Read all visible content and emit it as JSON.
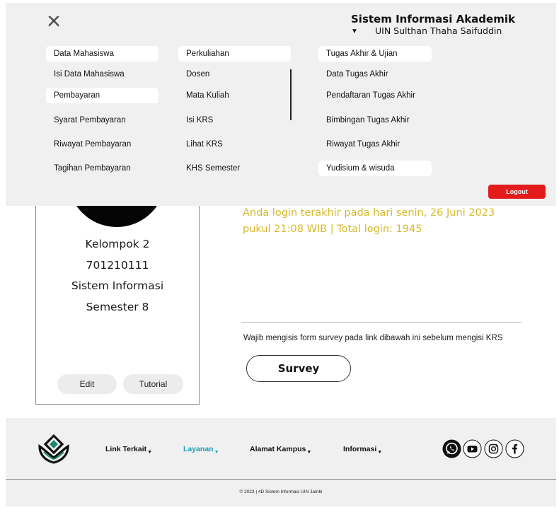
{
  "brand": {
    "title": "Sistem Informasi Akademik",
    "subtitle": "UIN Sulthan Thaha Saifuddin",
    "caret": "▼"
  },
  "menu": {
    "mahasiswa": {
      "header": "Data Mahasiswa",
      "items": [
        "Isi Data Mahasiswa"
      ]
    },
    "pembayaran": {
      "header": "Pembayaran",
      "items": [
        "Syarat Pembayaran",
        "Riwayat Pembayaran",
        "Tagihan Pembayaran"
      ]
    },
    "perkuliahan": {
      "header": "Perkuliahan",
      "items": [
        "Dosen",
        "Mata Kuliah",
        "Isi KRS",
        "Lihat KRS",
        "KHS Semester"
      ]
    },
    "tugas_akhir": {
      "header": "Tugas Akhir & Ujian",
      "items": [
        "Data Tugas Akhir",
        "Pendaftaran Tugas Akhir",
        "Bimbingan Tugas Akhir",
        "Riwayat Tugas Akhir"
      ]
    },
    "yudisium": {
      "header": "Yudisium & wisuda"
    },
    "logout_label": "Logout"
  },
  "profile": {
    "group": "Kelompok 2",
    "nim": "701210111",
    "program": "Sistem Informasi",
    "semester": "Semester 8",
    "edit_label": "Edit",
    "tutorial_label": "Tutorial"
  },
  "main": {
    "login_info": "Anda login terakhir pada hari senin, 26 Juni 2023 pukul 21:08 WIB | Total login: 1945",
    "survey_note": "Wajib mengisis form survey pada link dibawah ini sebelum mengisi KRS",
    "survey_label": "Survey"
  },
  "footer": {
    "links": [
      {
        "label": "Link Terkait",
        "active": false
      },
      {
        "label": "Layanan",
        "active": true
      },
      {
        "label": "Alamat Kampus",
        "active": false
      },
      {
        "label": "Informasi",
        "active": false
      }
    ],
    "caret": "▼",
    "social_icons": [
      "whatsapp-icon",
      "youtube-icon",
      "instagram-icon",
      "facebook-icon"
    ],
    "copyright": "© 2023 | 4D Sistem Informasi UIN Jambi"
  },
  "colors": {
    "login_info": "#d8b92a",
    "logout": "#e31b1b",
    "active_link": "#1aa0b8",
    "overlay_bg": "#f0f0f0"
  }
}
